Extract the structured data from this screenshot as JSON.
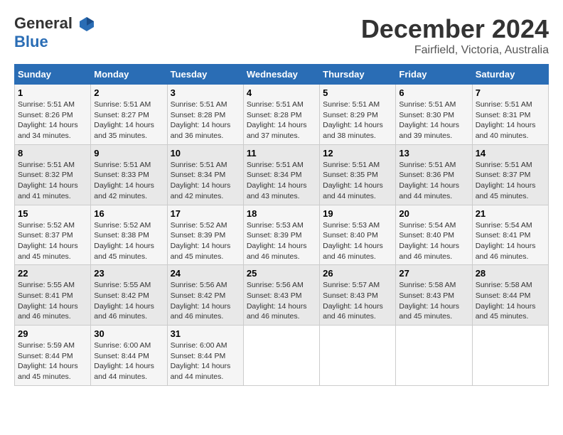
{
  "header": {
    "logo_line1": "General",
    "logo_line2": "Blue",
    "month": "December 2024",
    "location": "Fairfield, Victoria, Australia"
  },
  "days_of_week": [
    "Sunday",
    "Monday",
    "Tuesday",
    "Wednesday",
    "Thursday",
    "Friday",
    "Saturday"
  ],
  "weeks": [
    [
      {
        "day": "1",
        "sunrise": "5:51 AM",
        "sunset": "8:26 PM",
        "daylight": "14 hours and 34 minutes."
      },
      {
        "day": "2",
        "sunrise": "5:51 AM",
        "sunset": "8:27 PM",
        "daylight": "14 hours and 35 minutes."
      },
      {
        "day": "3",
        "sunrise": "5:51 AM",
        "sunset": "8:28 PM",
        "daylight": "14 hours and 36 minutes."
      },
      {
        "day": "4",
        "sunrise": "5:51 AM",
        "sunset": "8:28 PM",
        "daylight": "14 hours and 37 minutes."
      },
      {
        "day": "5",
        "sunrise": "5:51 AM",
        "sunset": "8:29 PM",
        "daylight": "14 hours and 38 minutes."
      },
      {
        "day": "6",
        "sunrise": "5:51 AM",
        "sunset": "8:30 PM",
        "daylight": "14 hours and 39 minutes."
      },
      {
        "day": "7",
        "sunrise": "5:51 AM",
        "sunset": "8:31 PM",
        "daylight": "14 hours and 40 minutes."
      }
    ],
    [
      {
        "day": "8",
        "sunrise": "5:51 AM",
        "sunset": "8:32 PM",
        "daylight": "14 hours and 41 minutes."
      },
      {
        "day": "9",
        "sunrise": "5:51 AM",
        "sunset": "8:33 PM",
        "daylight": "14 hours and 42 minutes."
      },
      {
        "day": "10",
        "sunrise": "5:51 AM",
        "sunset": "8:34 PM",
        "daylight": "14 hours and 42 minutes."
      },
      {
        "day": "11",
        "sunrise": "5:51 AM",
        "sunset": "8:34 PM",
        "daylight": "14 hours and 43 minutes."
      },
      {
        "day": "12",
        "sunrise": "5:51 AM",
        "sunset": "8:35 PM",
        "daylight": "14 hours and 44 minutes."
      },
      {
        "day": "13",
        "sunrise": "5:51 AM",
        "sunset": "8:36 PM",
        "daylight": "14 hours and 44 minutes."
      },
      {
        "day": "14",
        "sunrise": "5:51 AM",
        "sunset": "8:37 PM",
        "daylight": "14 hours and 45 minutes."
      }
    ],
    [
      {
        "day": "15",
        "sunrise": "5:52 AM",
        "sunset": "8:37 PM",
        "daylight": "14 hours and 45 minutes."
      },
      {
        "day": "16",
        "sunrise": "5:52 AM",
        "sunset": "8:38 PM",
        "daylight": "14 hours and 45 minutes."
      },
      {
        "day": "17",
        "sunrise": "5:52 AM",
        "sunset": "8:39 PM",
        "daylight": "14 hours and 45 minutes."
      },
      {
        "day": "18",
        "sunrise": "5:53 AM",
        "sunset": "8:39 PM",
        "daylight": "14 hours and 46 minutes."
      },
      {
        "day": "19",
        "sunrise": "5:53 AM",
        "sunset": "8:40 PM",
        "daylight": "14 hours and 46 minutes."
      },
      {
        "day": "20",
        "sunrise": "5:54 AM",
        "sunset": "8:40 PM",
        "daylight": "14 hours and 46 minutes."
      },
      {
        "day": "21",
        "sunrise": "5:54 AM",
        "sunset": "8:41 PM",
        "daylight": "14 hours and 46 minutes."
      }
    ],
    [
      {
        "day": "22",
        "sunrise": "5:55 AM",
        "sunset": "8:41 PM",
        "daylight": "14 hours and 46 minutes."
      },
      {
        "day": "23",
        "sunrise": "5:55 AM",
        "sunset": "8:42 PM",
        "daylight": "14 hours and 46 minutes."
      },
      {
        "day": "24",
        "sunrise": "5:56 AM",
        "sunset": "8:42 PM",
        "daylight": "14 hours and 46 minutes."
      },
      {
        "day": "25",
        "sunrise": "5:56 AM",
        "sunset": "8:43 PM",
        "daylight": "14 hours and 46 minutes."
      },
      {
        "day": "26",
        "sunrise": "5:57 AM",
        "sunset": "8:43 PM",
        "daylight": "14 hours and 46 minutes."
      },
      {
        "day": "27",
        "sunrise": "5:58 AM",
        "sunset": "8:43 PM",
        "daylight": "14 hours and 45 minutes."
      },
      {
        "day": "28",
        "sunrise": "5:58 AM",
        "sunset": "8:44 PM",
        "daylight": "14 hours and 45 minutes."
      }
    ],
    [
      {
        "day": "29",
        "sunrise": "5:59 AM",
        "sunset": "8:44 PM",
        "daylight": "14 hours and 45 minutes."
      },
      {
        "day": "30",
        "sunrise": "6:00 AM",
        "sunset": "8:44 PM",
        "daylight": "14 hours and 44 minutes."
      },
      {
        "day": "31",
        "sunrise": "6:00 AM",
        "sunset": "8:44 PM",
        "daylight": "14 hours and 44 minutes."
      },
      null,
      null,
      null,
      null
    ]
  ]
}
